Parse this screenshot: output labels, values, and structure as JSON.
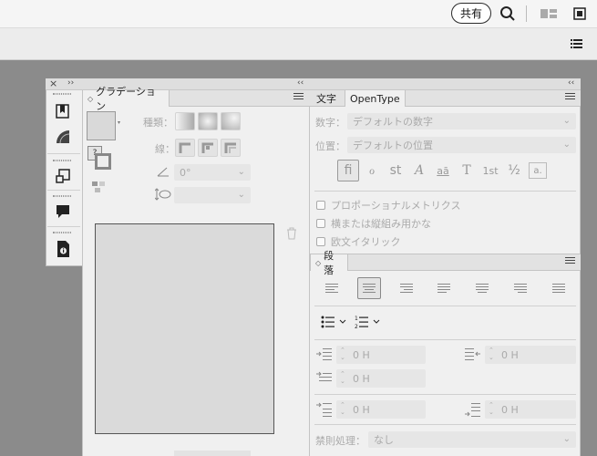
{
  "topbar": {
    "share_label": "共有",
    "icons": [
      "search-icon",
      "panels-layout-icon",
      "arrange-document-icon"
    ]
  },
  "secbar": {
    "icons": [
      "list-menu-icon"
    ]
  },
  "toolsPanel": {
    "collapse_glyph": "››",
    "close_glyph": "×",
    "tools": [
      "bookmark-icon",
      "gradient-shape-icon",
      "transform-icon",
      "comment-icon",
      "document-info-icon"
    ]
  },
  "gradient": {
    "tab_label": "グラデーション",
    "type_label": "種類：",
    "stroke_label": "線：",
    "angle_value": "0°",
    "collapse_glyph": "‹‹",
    "question_glyph": "?"
  },
  "character": {
    "tab_text_label": "文字",
    "tab_opentype_label": "OpenType",
    "collapse_glyph": "‹‹",
    "number_label": "数字：",
    "number_value": "デフォルトの数字",
    "position_label": "位置：",
    "position_value": "デフォルトの位置",
    "glyphs": [
      "ﬁ",
      "ℴ",
      "st",
      "A",
      "aā",
      "T",
      "1st",
      "½",
      "a."
    ],
    "checkbox_proportional": "プロポーショナルメトリクス",
    "checkbox_vertical": "横または縦組み用かな",
    "checkbox_roman_italic": "欧文イタリック"
  },
  "paragraph": {
    "tab_label": "段落",
    "indent_left_value": "0 H",
    "indent_right_value": "0 H",
    "first_line_value": "0 H",
    "space_before_value": "0 H",
    "space_after_value": "0 H",
    "kinsoku_label": "禁則処理：",
    "kinsoku_value": "なし"
  }
}
